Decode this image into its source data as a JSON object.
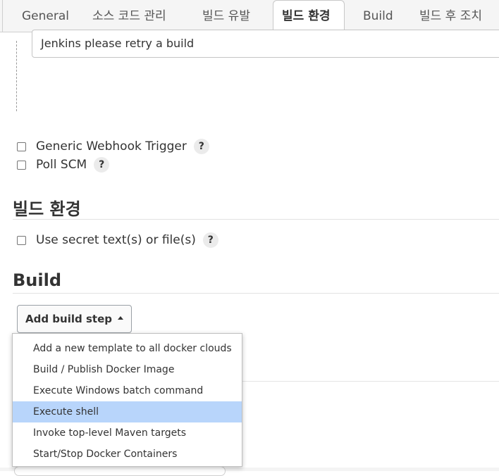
{
  "tabs": [
    {
      "label": "General"
    },
    {
      "label": "소스 코드 관리"
    },
    {
      "label": "빌드 유발"
    },
    {
      "label": "빌드 환경"
    },
    {
      "label": "Build"
    },
    {
      "label": "빌드 후 조치"
    }
  ],
  "active_tab": "빌드 환경",
  "retry_text": "Jenkins please retry a build",
  "triggers": {
    "generic_webhook": "Generic Webhook Trigger",
    "poll_scm": "Poll SCM"
  },
  "help_glyph": "?",
  "build_env": {
    "title": "빌드 환경",
    "secret_label": "Use secret text(s) or file(s)"
  },
  "build": {
    "title": "Build",
    "add_step_label": "Add build step"
  },
  "menu": {
    "items": [
      "Add a new template to all docker clouds",
      "Build / Publish Docker Image",
      "Execute Windows batch command",
      "Execute shell",
      "Invoke top-level Maven targets",
      "Start/Stop Docker Containers"
    ],
    "highlighted": "Execute shell"
  },
  "colors": {
    "highlight": "#b8d5fb",
    "tab_bar": "#f5f5f5"
  }
}
